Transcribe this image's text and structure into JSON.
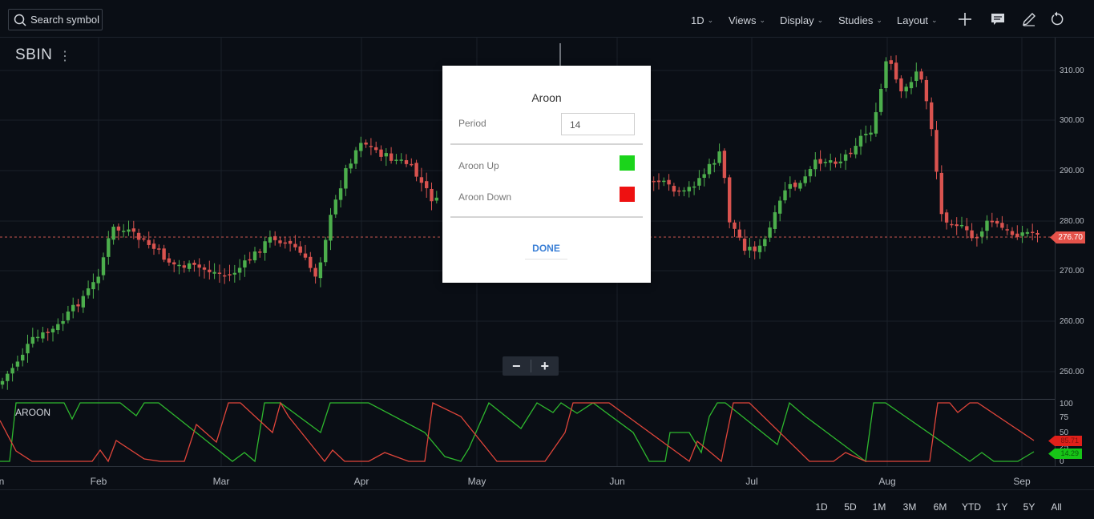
{
  "toolbar": {
    "search_placeholder": "Search symbol",
    "interval": "1D",
    "views": "Views",
    "display": "Display",
    "studies": "Studies",
    "layout": "Layout"
  },
  "chart": {
    "symbol": "SBIN",
    "current_price": "276.70",
    "price_ticks": [
      "310.00",
      "300.00",
      "290.00",
      "280.00",
      "270.00",
      "260.00",
      "250.00"
    ],
    "indicator_label": "AROON",
    "aroon_ticks": [
      "100",
      "75",
      "50",
      "25",
      "0"
    ],
    "aroon_down_value": "85.71",
    "aroon_up_value": "14.29",
    "up_color": "#2eb82e",
    "down_color": "#e0453a",
    "months": [
      "Feb",
      "Mar",
      "Apr",
      "May",
      "Jun",
      "Jul",
      "Aug",
      "Sep"
    ]
  },
  "modal": {
    "title": "Aroon",
    "period_label": "Period",
    "period_value": "14",
    "aroon_up_label": "Aroon Up",
    "aroon_up_color": "#1bd41b",
    "aroon_down_label": "Aroon Down",
    "aroon_down_color": "#ee1111",
    "done_label": "DONE"
  },
  "zoom": {
    "minus": "−",
    "plus": "+"
  },
  "ranges": [
    "1D",
    "5D",
    "1M",
    "3M",
    "6M",
    "YTD",
    "1Y",
    "5Y",
    "All"
  ]
}
